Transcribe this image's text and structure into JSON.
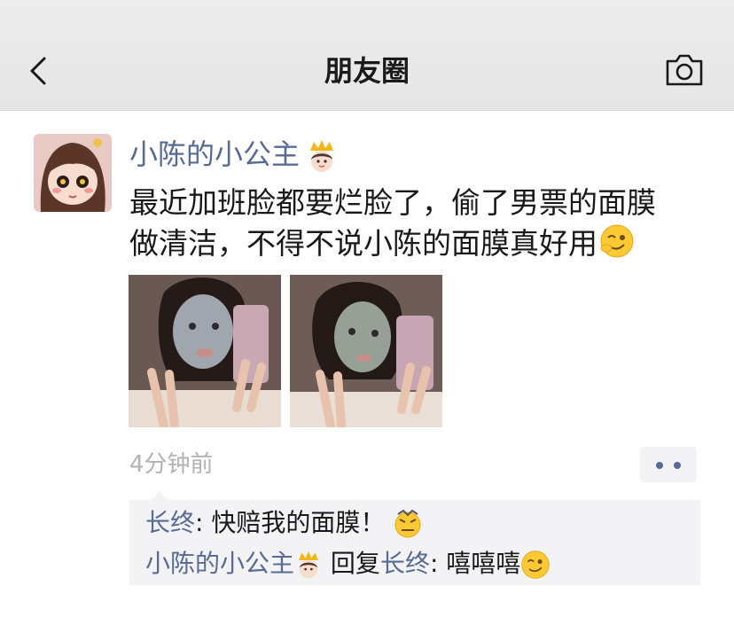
{
  "header": {
    "title": "朋友圈"
  },
  "post": {
    "author": "小陈的小公主",
    "text": "最近加班脸都要烂脸了，偷了男票的面膜\n做清洁，不得不说小陈的面膜真好用",
    "time": "4分钟前"
  },
  "comments": [
    {
      "name": "长终",
      "sep": ": ",
      "text": "快赔我的面膜！"
    },
    {
      "name": "小陈的小公主",
      "reply_word": "回复",
      "reply_to": "长终",
      "sep": ": ",
      "text": "嘻嘻嘻"
    }
  ],
  "icons": [
    "back-chevron-icon",
    "camera-icon",
    "crown-woman-icon",
    "wink-emoji-icon",
    "angry-emoji-icon"
  ],
  "colors": {
    "name_blue": "#576b95",
    "time_gray": "#b2b2b2",
    "comment_bg": "#f3f3f5"
  }
}
